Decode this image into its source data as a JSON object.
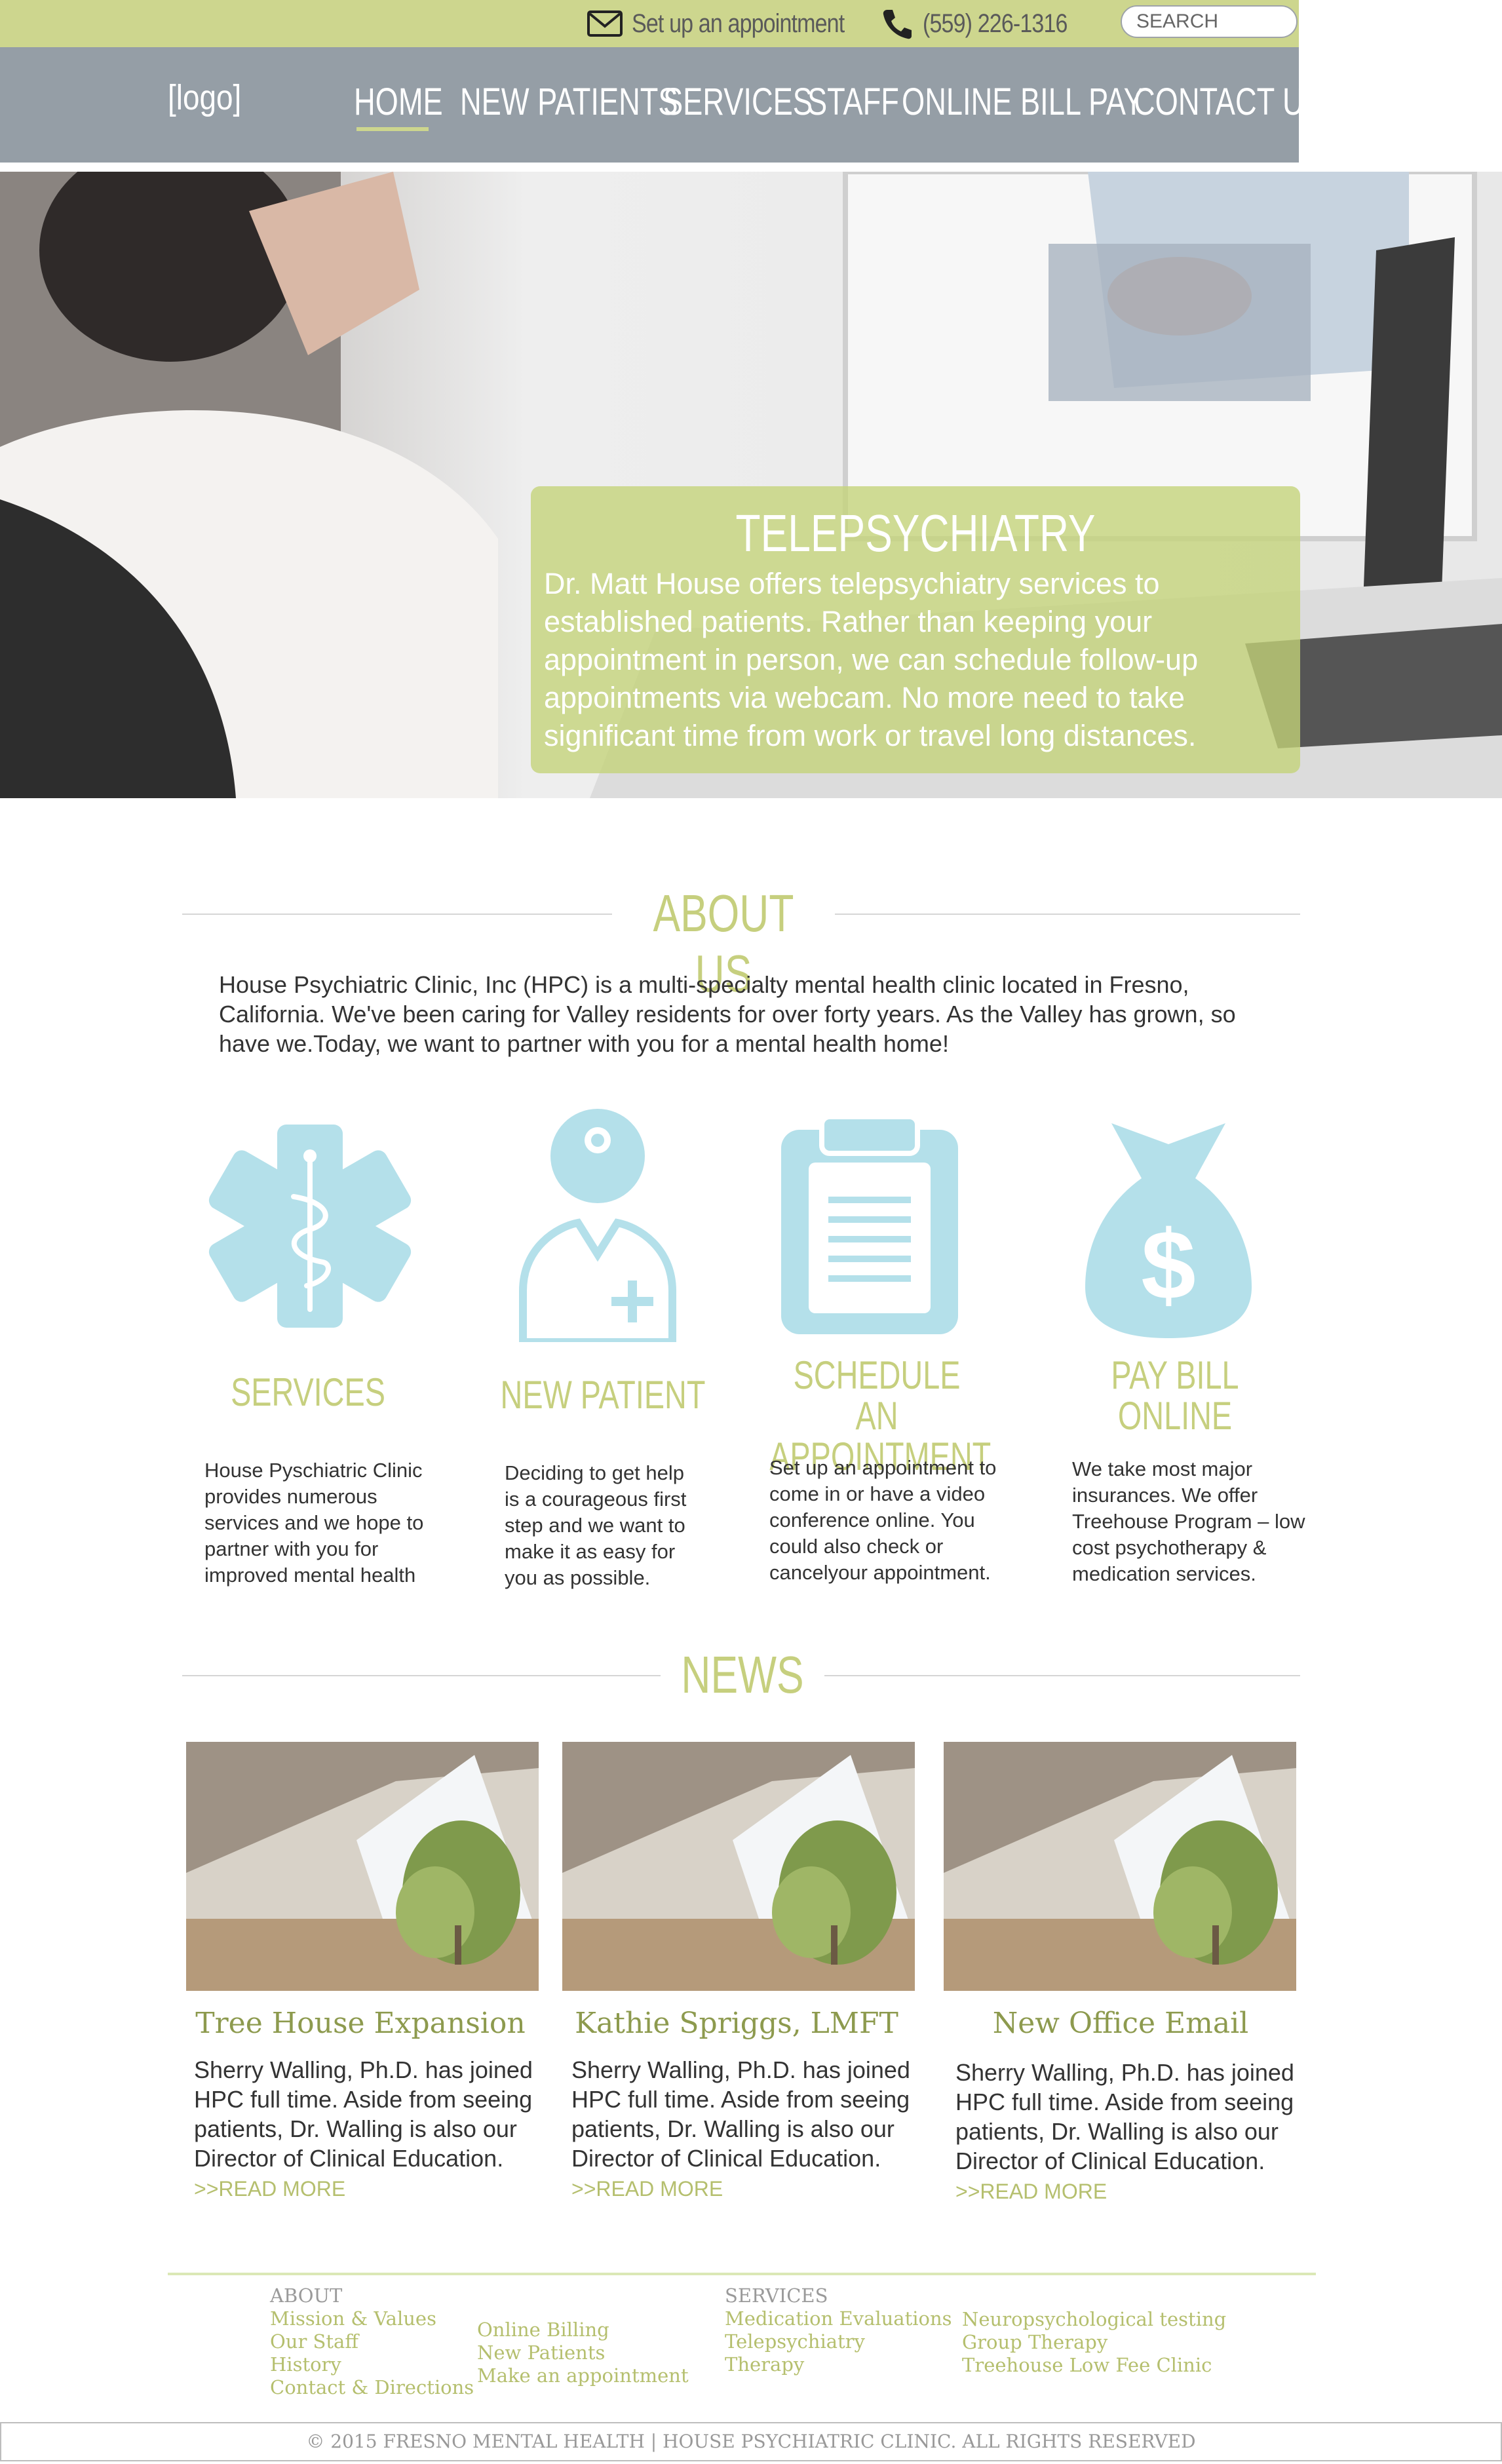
{
  "topbar": {
    "appointment_label": "Set up an appointment",
    "phone": "(559) 226-1316",
    "search_placeholder": "SEARCH",
    "accent": "#cdd68e"
  },
  "nav": {
    "logo": "[logo]",
    "items": [
      {
        "label": "HOME",
        "active": true
      },
      {
        "label": "NEW PATIENTS"
      },
      {
        "label": "SERVICES"
      },
      {
        "label": "STAFF"
      },
      {
        "label": "ONLINE BILL PAY"
      },
      {
        "label": "CONTACT US"
      }
    ],
    "background": "#959ea6"
  },
  "hero": {
    "title": "TELEPSYCHIATRY",
    "body": "Dr. Matt House offers telepsychiatry services to established patients. Rather than keeping your appointment in person, we can schedule follow-up appointments via webcam. No more need to take significant time from work or travel long distances."
  },
  "about": {
    "heading": "ABOUT US",
    "text": "House Psychiatric Clinic, Inc (HPC) is a multi-specialty mental health clinic located in Fresno, California.  We've been caring for Valley residents for over forty years.  As the Valley has grown, so have we.Today, we want to partner with you for a mental health home!"
  },
  "features": [
    {
      "icon": "caduceus-star-icon",
      "title": "SERVICES",
      "text": "House Pyschiatric Clinic provides numerous services and we hope to partner with you for improved mental health"
    },
    {
      "icon": "doctor-icon",
      "title": "NEW PATIENT",
      "text": "Deciding to get help is a courageous first step and we want to make it as easy for you as possible."
    },
    {
      "icon": "clipboard-icon",
      "title": "SCHEDULE AN APPOINTMENT",
      "text": "Set up an appointment to come in or have a video conference online. You could also check or cancelyour appointment."
    },
    {
      "icon": "money-bag-icon",
      "title": "PAY BILL ONLINE",
      "text": "We take most major insurances. We offer Treehouse Program – low cost psychotherapy & medication services."
    }
  ],
  "icon_color": "#b4e0ea",
  "news": {
    "heading": "NEWS",
    "items": [
      {
        "title": "Tree House Expansion",
        "body": "Sherry Walling, Ph.D. has joined HPC full time.  Aside from seeing patients, Dr. Walling is also our Director of Clinical Education.",
        "read_more": ">>READ MORE"
      },
      {
        "title": "Kathie Spriggs, LMFT",
        "body": "Sherry Walling, Ph.D. has joined HPC full time.  Aside from seeing patients, Dr. Walling is also our Director of Clinical Education.",
        "read_more": ">>READ MORE"
      },
      {
        "title": "New Office Email",
        "body": "Sherry Walling, Ph.D. has joined HPC full time.  Aside from seeing patients, Dr. Walling is also our Director of Clinical Education.",
        "read_more": ">>READ MORE"
      }
    ]
  },
  "footer": {
    "about_heading": "ABOUT",
    "about_links": [
      "Mission & Values",
      "Our Staff",
      "History",
      "Contact & Directions"
    ],
    "misc_links": [
      "Online Billing",
      "New Patients",
      "Make an appointment"
    ],
    "services_heading": "SERVICES",
    "services_links": [
      "Medication Evaluations",
      "Telepsychiatry",
      "Therapy"
    ],
    "services_links_2": [
      "Neuropsychological testing",
      "Group Therapy",
      "Treehouse Low Fee Clinic"
    ],
    "copyright": "© 2015 FRESNO MENTAL HEALTH | HOUSE PSYCHIATRIC CLINIC. ALL RIGHTS RESERVED"
  }
}
